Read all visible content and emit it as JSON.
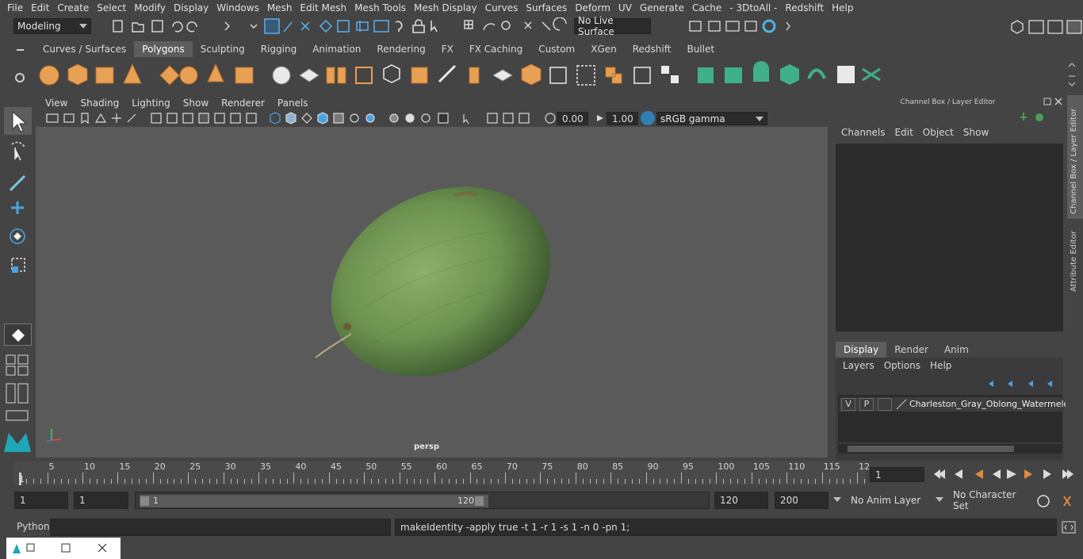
{
  "menubar": [
    "File",
    "Edit",
    "Create",
    "Select",
    "Modify",
    "Display",
    "Windows",
    "Mesh",
    "Edit Mesh",
    "Mesh Tools",
    "Mesh Display",
    "Curves",
    "Surfaces",
    "Deform",
    "UV",
    "Generate",
    "Cache",
    "- 3DtoAll -",
    "Redshift",
    "Help"
  ],
  "status": {
    "mode": "Modeling",
    "live_surface": "No Live Surface"
  },
  "shelf_tabs": [
    "Curves / Surfaces",
    "Polygons",
    "Sculpting",
    "Rigging",
    "Animation",
    "Rendering",
    "FX",
    "FX Caching",
    "Custom",
    "XGen",
    "Redshift",
    "Bullet"
  ],
  "shelf_active": "Polygons",
  "viewport": {
    "menu": [
      "View",
      "Shading",
      "Lighting",
      "Show",
      "Renderer",
      "Panels"
    ],
    "exposure": "0.00",
    "gamma": "1.00",
    "color_space": "sRGB gamma",
    "camera_label": "persp"
  },
  "channel_box": {
    "title": "Channel Box / Layer Editor",
    "menu": [
      "Channels",
      "Edit",
      "Object",
      "Show"
    ],
    "tabs": [
      "Display",
      "Render",
      "Anim"
    ],
    "active_tab": "Display",
    "layer_menu": [
      "Layers",
      "Options",
      "Help"
    ],
    "layer": {
      "v": "V",
      "p": "P",
      "name": "Charleston_Gray_Oblong_Watermelo"
    }
  },
  "side_tabs": {
    "channel": "Channel Box / Layer Editor",
    "attr": "Attribute Editor"
  },
  "timeline": {
    "ticks": [
      "5",
      "10",
      "15",
      "20",
      "25",
      "30",
      "35",
      "40",
      "45",
      "50",
      "55",
      "60",
      "65",
      "70",
      "75",
      "80",
      "85",
      "90",
      "95",
      "100",
      "105",
      "110",
      "115",
      "12"
    ],
    "start_frame": "1",
    "current_frame": "1"
  },
  "range": {
    "start": "1",
    "playback_start": "1",
    "slider_start": "1",
    "slider_end": "120",
    "playback_end": "120",
    "end": "200",
    "anim_layer": "No Anim Layer",
    "char_set": "No Character Set"
  },
  "command": {
    "label": "Python",
    "input": "",
    "feedback": "makeIdentity -apply true -t 1 -r 1 -s 1 -n 0 -pn 1;"
  },
  "colors": {
    "bg": "#444444",
    "viewport": "#5a5a5a",
    "field": "#2b2b2b",
    "shelf_orange": "#e8a055",
    "shelf_green": "#3fb08a",
    "accent_blue": "#4aa3df"
  }
}
